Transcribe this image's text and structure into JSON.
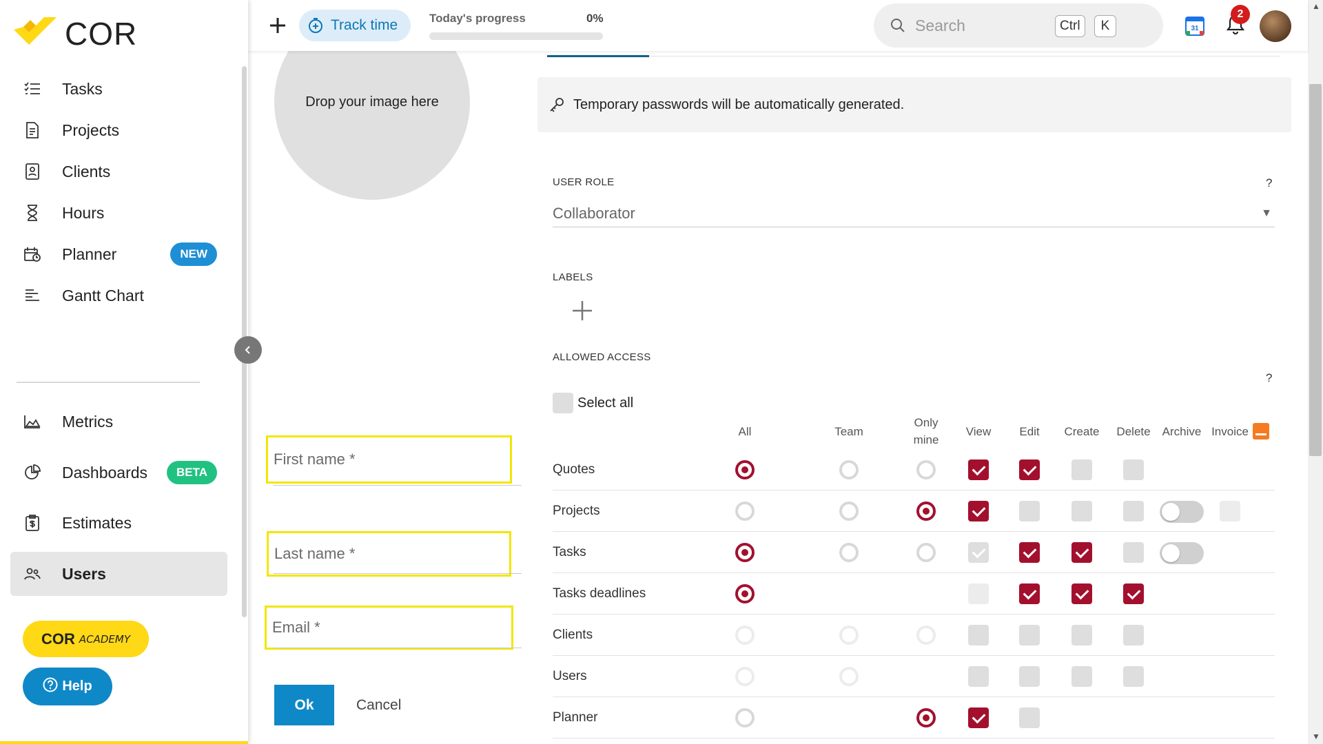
{
  "app": {
    "brand": "COR"
  },
  "sidebar": {
    "items": [
      {
        "label": "Tasks",
        "icon": "checklist-icon"
      },
      {
        "label": "Projects",
        "icon": "document-icon"
      },
      {
        "label": "Clients",
        "icon": "contact-card-icon"
      },
      {
        "label": "Hours",
        "icon": "hourglass-icon"
      },
      {
        "label": "Planner",
        "icon": "calendar-icon",
        "badge": "NEW"
      },
      {
        "label": "Gantt Chart",
        "icon": "gantt-icon"
      },
      {
        "label": "Metrics",
        "icon": "area-chart-icon"
      },
      {
        "label": "Dashboards",
        "icon": "pie-chart-icon",
        "badge": "BETA"
      },
      {
        "label": "Estimates",
        "icon": "estimate-icon"
      },
      {
        "label": "Users",
        "icon": "users-icon",
        "active": true
      }
    ],
    "academy": {
      "cor": "COR",
      "academy": "ACADEMY"
    },
    "help_label": "Help"
  },
  "topbar": {
    "track_time": "Track time",
    "progress_label": "Today's progress",
    "progress_value": "0%",
    "progress_fraction": 0,
    "search_placeholder": "Search",
    "shortcut": [
      "Ctrl",
      "K"
    ],
    "notifications": "2",
    "calendar_day": "31"
  },
  "form": {
    "drop_text": "Drop your image here",
    "first_name_placeholder": "First name *",
    "last_name_placeholder": "Last name *",
    "email_placeholder": "Email *",
    "ok_label": "Ok",
    "cancel_label": "Cancel"
  },
  "details": {
    "notice": "Temporary passwords will be automatically generated.",
    "user_role_label": "USER ROLE",
    "help_mark": "?",
    "user_role_value": "Collaborator",
    "labels_label": "LABELS",
    "allowed_access_label": "ALLOWED ACCESS",
    "select_all": "Select all"
  },
  "permissions": {
    "columns": [
      "All",
      "Team",
      "Only mine",
      "View",
      "Edit",
      "Create",
      "Delete",
      "Archive",
      "Invoice"
    ],
    "rows": [
      {
        "label": "Quotes",
        "cells": {
          "all": "radio-on",
          "team": "radio",
          "mine": "radio",
          "view": "check-on",
          "edit": "check-on",
          "create": "check",
          "delete": "check"
        }
      },
      {
        "label": "Projects",
        "cells": {
          "all": "radio",
          "team": "radio",
          "mine": "radio-on",
          "view": "check-on",
          "edit": "check",
          "create": "check",
          "delete": "check",
          "archive": "toggle",
          "invoice": "check-light"
        }
      },
      {
        "label": "Tasks",
        "cells": {
          "all": "radio-on",
          "team": "radio",
          "mine": "radio",
          "view": "check-faded",
          "edit": "check-on",
          "create": "check-on",
          "delete": "check",
          "archive": "toggle"
        }
      },
      {
        "label": "Tasks deadlines",
        "cells": {
          "all": "radio-on",
          "view": "check-light",
          "edit": "check-on",
          "create": "check-on",
          "delete": "check-on"
        }
      },
      {
        "label": "Clients",
        "cells": {
          "all": "radio-light",
          "team": "radio-light",
          "mine": "radio-light",
          "view": "check",
          "edit": "check",
          "create": "check",
          "delete": "check"
        }
      },
      {
        "label": "Users",
        "cells": {
          "all": "radio-light",
          "team": "radio-light",
          "view": "check",
          "edit": "check",
          "create": "check",
          "delete": "check"
        }
      },
      {
        "label": "Planner",
        "cells": {
          "all": "radio",
          "mine": "radio-on",
          "view": "check-on",
          "edit": "check"
        }
      }
    ]
  },
  "colors": {
    "accent": "#0f88c8",
    "brand_yellow": "#ffd816",
    "perm_on": "#a3102e",
    "highlight": "#f2e600"
  }
}
